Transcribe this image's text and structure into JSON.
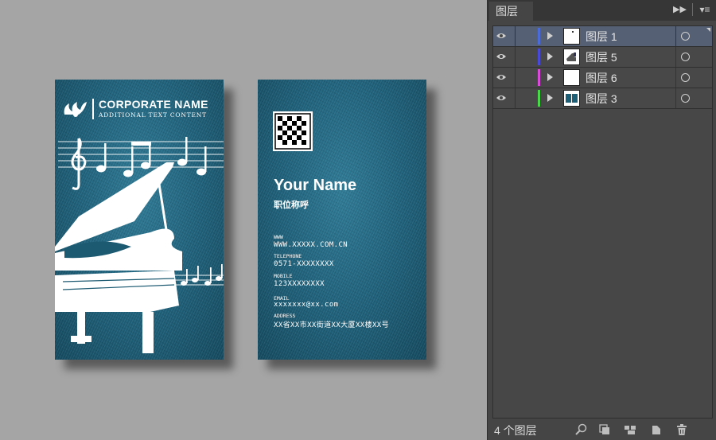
{
  "front_card": {
    "corporate_name": "CORPORATE NAME",
    "additional_text": "ADDITIONAL TEXT CONTENT"
  },
  "back_card": {
    "name": "Your Name",
    "title": "职位称呼",
    "contacts": [
      {
        "label": "WWW",
        "value": "WWW.XXXXX.COM.CN"
      },
      {
        "label": "TELEPHONE",
        "value": "0571-XXXXXXXX"
      },
      {
        "label": "MOBILE",
        "value": "123XXXXXXXX"
      },
      {
        "label": "EMAIL",
        "value": "xxxxxxx@xx.com"
      },
      {
        "label": "ADDRESS",
        "value": "XX省XX市XX街道XX大厦XX楼XX号"
      }
    ]
  },
  "layers_panel": {
    "tab_label": "图层",
    "layers": [
      {
        "name": "图层 1",
        "color": "#4a6bd8",
        "selected": true,
        "thumbnail": "dot"
      },
      {
        "name": "图层 5",
        "color": "#4a4ad8",
        "selected": false,
        "thumbnail": "piano"
      },
      {
        "name": "图层 6",
        "color": "#d84ad8",
        "selected": false,
        "thumbnail": "blank"
      },
      {
        "name": "图层 3",
        "color": "#4ad84a",
        "selected": false,
        "thumbnail": "cards"
      }
    ],
    "footer": {
      "layer_count": "4 个图层"
    }
  }
}
